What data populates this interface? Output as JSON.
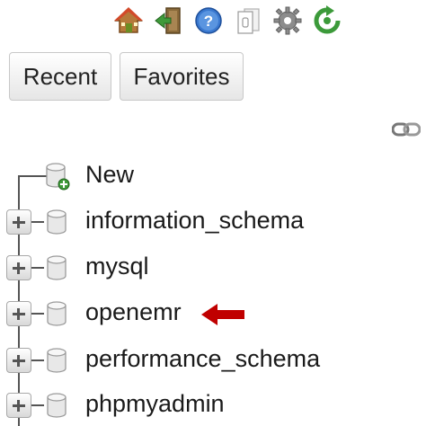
{
  "toolbar": {
    "icons": [
      "home-icon",
      "exit-icon",
      "help-icon",
      "documentation-icon",
      "settings-icon",
      "reload-icon"
    ]
  },
  "tabs": {
    "recent_label": "Recent",
    "favorites_label": "Favorites"
  },
  "tree": {
    "new_label": "New",
    "databases": [
      {
        "label": "information_schema"
      },
      {
        "label": "mysql"
      },
      {
        "label": "openemr"
      },
      {
        "label": "performance_schema"
      },
      {
        "label": "phpmyadmin"
      }
    ]
  },
  "annotation": {
    "arrow_color": "#c00000"
  }
}
